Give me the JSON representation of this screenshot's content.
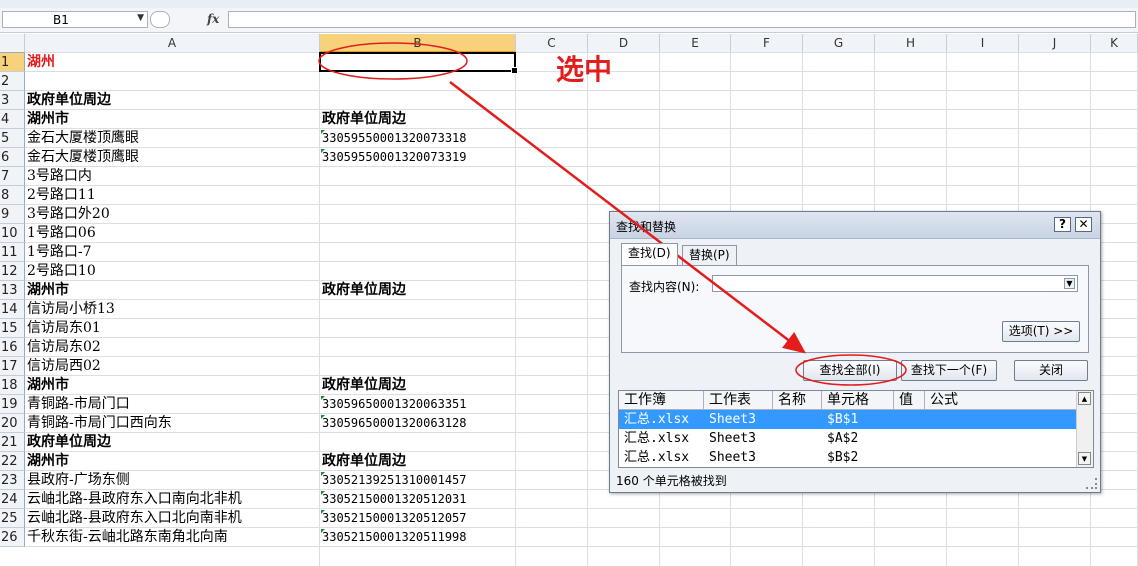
{
  "formula_bar": {
    "name_box": "B1",
    "fx_label": "fx",
    "formula": ""
  },
  "columns": [
    "A",
    "B",
    "C",
    "D",
    "E",
    "F",
    "G",
    "H",
    "I",
    "J",
    "K"
  ],
  "rows": [
    {
      "n": "1",
      "a": "湖州",
      "a_style": "red",
      "b": "",
      "b_style": ""
    },
    {
      "n": "2",
      "a": "",
      "a_style": "",
      "b": "",
      "b_style": ""
    },
    {
      "n": "3",
      "a": "政府单位周边",
      "a_style": "bold",
      "b": "",
      "b_style": ""
    },
    {
      "n": "4",
      "a": "湖州市",
      "a_style": "bold",
      "b": "政府单位周边",
      "b_style": "bold"
    },
    {
      "n": "5",
      "a": "金石大厦楼顶鹰眼",
      "a_style": "",
      "b": "33059550001320073318",
      "b_style": "num"
    },
    {
      "n": "6",
      "a": "金石大厦楼顶鹰眼",
      "a_style": "",
      "b": "33059550001320073319",
      "b_style": "num"
    },
    {
      "n": "7",
      "a": "3号路口内",
      "a_style": "",
      "b": "",
      "b_style": ""
    },
    {
      "n": "8",
      "a": "2号路口11",
      "a_style": "",
      "b": "",
      "b_style": ""
    },
    {
      "n": "9",
      "a": "3号路口外20",
      "a_style": "",
      "b": "",
      "b_style": ""
    },
    {
      "n": "10",
      "a": "1号路口06",
      "a_style": "",
      "b": "",
      "b_style": ""
    },
    {
      "n": "11",
      "a": "1号路口-7",
      "a_style": "",
      "b": "",
      "b_style": ""
    },
    {
      "n": "12",
      "a": "2号路口10",
      "a_style": "",
      "b": "",
      "b_style": ""
    },
    {
      "n": "13",
      "a": "湖州市",
      "a_style": "bold",
      "b": "政府单位周边",
      "b_style": "bold"
    },
    {
      "n": "14",
      "a": "信访局小桥13",
      "a_style": "",
      "b": "",
      "b_style": ""
    },
    {
      "n": "15",
      "a": "信访局东01",
      "a_style": "",
      "b": "",
      "b_style": ""
    },
    {
      "n": "16",
      "a": "信访局东02",
      "a_style": "",
      "b": "",
      "b_style": ""
    },
    {
      "n": "17",
      "a": "信访局西02",
      "a_style": "",
      "b": "",
      "b_style": ""
    },
    {
      "n": "18",
      "a": "湖州市",
      "a_style": "bold",
      "b": "政府单位周边",
      "b_style": "bold"
    },
    {
      "n": "19",
      "a": "青铜路-市局门口",
      "a_style": "",
      "b": "33059650001320063351",
      "b_style": "num"
    },
    {
      "n": "20",
      "a": "青铜路-市局门口西向东",
      "a_style": "",
      "b": "33059650001320063128",
      "b_style": "num"
    },
    {
      "n": "21",
      "a": "政府单位周边",
      "a_style": "bold",
      "b": "",
      "b_style": ""
    },
    {
      "n": "22",
      "a": "湖州市",
      "a_style": "bold",
      "b": "政府单位周边",
      "b_style": "bold"
    },
    {
      "n": "23",
      "a": "县政府-广场东侧",
      "a_style": "",
      "b": "33052139251310001457",
      "b_style": "num"
    },
    {
      "n": "24",
      "a": "云岫北路-县政府东入口南向北非机",
      "a_style": "",
      "b": "33052150001320512031",
      "b_style": "num"
    },
    {
      "n": "25",
      "a": "云岫北路-县政府东入口北向南非机",
      "a_style": "",
      "b": "33052150001320512057",
      "b_style": "num"
    },
    {
      "n": "26",
      "a": "千秋东街-云岫北路东南角北向南",
      "a_style": "",
      "b": "33052150001320511998",
      "b_style": "num"
    }
  ],
  "annotation": "选中",
  "dialog": {
    "title": "查找和替换",
    "help": "?",
    "close": "✕",
    "tabs": [
      "查找(D)",
      "替换(P)"
    ],
    "find_label": "查找内容(N):",
    "find_value": "",
    "options_button": "选项(T) >>",
    "find_all_button": "查找全部(I)",
    "find_next_button": "查找下一个(F)",
    "close_button": "关闭",
    "results_headers": [
      "工作簿",
      "工作表",
      "名称",
      "单元格",
      "值",
      "公式"
    ],
    "results": [
      {
        "book": "汇总.xlsx",
        "sheet": "Sheet3",
        "name": "",
        "cell": "$B$1",
        "value": "",
        "formula": ""
      },
      {
        "book": "汇总.xlsx",
        "sheet": "Sheet3",
        "name": "",
        "cell": "$A$2",
        "value": "",
        "formula": ""
      },
      {
        "book": "汇总.xlsx",
        "sheet": "Sheet3",
        "name": "",
        "cell": "$B$2",
        "value": "",
        "formula": ""
      }
    ],
    "status": "160 个单元格被找到"
  },
  "colors": {
    "annotation": "#e31c1c",
    "selection": "#3399ff",
    "header_selected": "#f8d27a"
  }
}
